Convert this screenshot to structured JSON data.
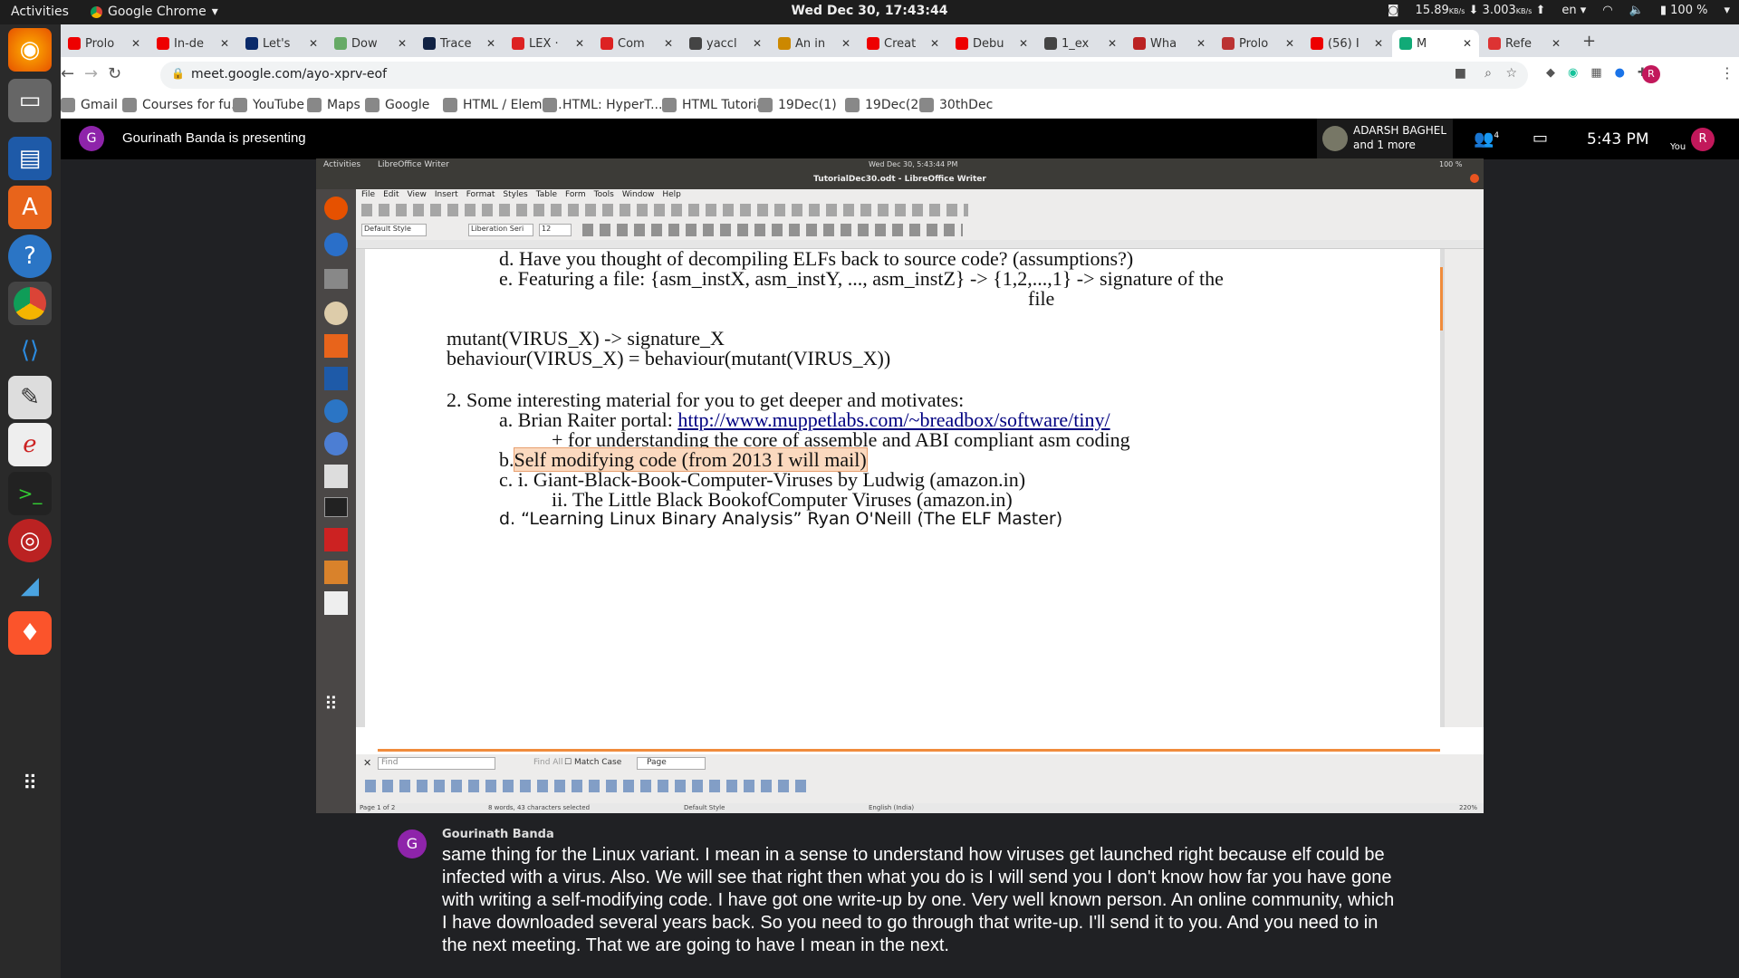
{
  "os_bar": {
    "activities": "Activities",
    "app": "Google Chrome",
    "clock": "Wed Dec 30, 17:43:44",
    "net_down": "15.89",
    "net_unit1": "KB/s",
    "net_up": "3.003",
    "net_unit2": "KB/s",
    "lang": "en",
    "battery": "100 %"
  },
  "dock": [
    "firefox-icon",
    "files-icon",
    "writer-icon",
    "software-icon",
    "help-icon",
    "chrome-icon",
    "vscode-icon",
    "editor-icon",
    "document-icon",
    "terminal-icon",
    "mendeley-icon",
    "wireshark-icon",
    "brave-icon",
    "apps-grid-icon"
  ],
  "tabs": [
    {
      "label": "Prolo",
      "color": "#e00"
    },
    {
      "label": "In-de",
      "color": "#e00"
    },
    {
      "label": "Let's",
      "color": "#0a2a6a"
    },
    {
      "label": "Dow",
      "color": "#6a6"
    },
    {
      "label": "Trace",
      "color": "#124"
    },
    {
      "label": "LEX ·",
      "color": "#d22"
    },
    {
      "label": "Com",
      "color": "#d22"
    },
    {
      "label": "yaccl",
      "color": "#444"
    },
    {
      "label": "An in",
      "color": "#c80"
    },
    {
      "label": "Creat",
      "color": "#e00"
    },
    {
      "label": "Debu",
      "color": "#e00"
    },
    {
      "label": "1_ex",
      "color": "#444"
    },
    {
      "label": "Wha",
      "color": "#b22"
    },
    {
      "label": "Prolo",
      "color": "#b33"
    },
    {
      "label": "(56) I",
      "color": "#e00"
    },
    {
      "label": "M",
      "color": "#1a7"
    },
    {
      "label": "Refe",
      "color": "#d33"
    }
  ],
  "omnibox": {
    "url": "meet.google.com/ayo-xprv-eof"
  },
  "bookmarks": [
    "Gmail",
    "Courses for fu...",
    "YouTube",
    "Maps",
    "Google",
    "HTML / Eleme...",
    "HTML: HyperT...",
    "HTML Tutorial",
    "19Dec(1)",
    "19Dec(2)",
    "30thDec"
  ],
  "meet": {
    "presenter_initial": "G",
    "presenting_text": "Gourinath Banda is presenting",
    "participant_name": "ADARSH BAGHEL",
    "participant_more": "and 1 more",
    "people_count": "4",
    "time": "5:43  PM",
    "you_label": "You",
    "you_initial": "R"
  },
  "inner": {
    "activities": "Activities",
    "app": "LibreOffice Writer",
    "clock": "Wed Dec 30,  5:43:44 PM",
    "battery": "100 %",
    "title": "TutorialDec30.odt - LibreOffice Writer",
    "menu": [
      "File",
      "Edit",
      "View",
      "Insert",
      "Format",
      "Styles",
      "Table",
      "Form",
      "Tools",
      "Window",
      "Help"
    ],
    "style_box": "Default Style",
    "font_box": "Liberation Seri",
    "size_box": "12",
    "find_placeholder": "Find",
    "find_all": "Find All",
    "match_case": "Match Case",
    "page_sel": "Page",
    "status_page": "Page 1 of 2",
    "status_words": "8 words, 43 characters selected",
    "status_style": "Default Style",
    "status_lang": "English (India)",
    "status_zoom": "220%"
  },
  "doc": {
    "l1": "d. Have you thought of decompiling ELFs back to source code? (assumptions?)",
    "l2": "e. Featuring a file: {asm_instX, asm_instY, ..., asm_instZ} -> {1,2,...,1} -> signature of the",
    "l3": "file",
    "l4": "mutant(VIRUS_X) -> signature_X",
    "l5": "behaviour(VIRUS_X) = behaviour(mutant(VIRUS_X))",
    "l6": "2. Some interesting material for you to get deeper and motivates:",
    "l7a": "a. Brian Raiter portal: ",
    "l7link": "http://www.muppetlabs.com/~breadbox/software/tiny/",
    "l8": "+ for understanding the core of assemble and ABI compliant asm coding",
    "l9a": "b.",
    "l9sel": "Self modifying code (from 2013 I will mail)",
    "l10": "c. i. Giant-Black-Book-Computer-Viruses by Ludwig (amazon.in)",
    "l11": "ii. The Little Black BookofComputer Viruses  (amazon.in)",
    "l12": "d. “Learning Linux Binary Analysis” Ryan O'Neill (The ELF Master)"
  },
  "caption": {
    "initial": "G",
    "speaker": "Gourinath Banda",
    "text": "same thing for the Linux variant. I mean in a sense to understand how viruses get launched right because elf could be infected with a virus. Also. We will see that right then what you do is I will send you I don't know how far you have gone with writing a self-modifying code. I have got one write-up by one. Very well known person. An online community, which I have downloaded several years back. So you need to go through that write-up. I'll send it to you. And you need to in the next meeting. That we are going to have I mean in the next."
  }
}
